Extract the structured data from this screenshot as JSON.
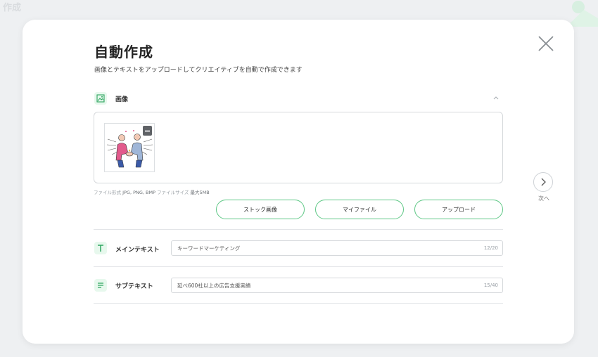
{
  "background": {
    "title": "作成"
  },
  "modal": {
    "title": "自動作成",
    "subtitle": "画像とテキストをアップロードしてクリエイティブを自動で作成できます",
    "next_label": "次へ",
    "image_section": {
      "label": "画像",
      "file_format_label": "ファイル形式",
      "file_format_value": "JPG, PNG, BMP",
      "file_size_label": "ファイルサイズ",
      "file_size_value": "最大5MB",
      "buttons": {
        "stock": "ストック画像",
        "my_files": "マイファイル",
        "upload": "アップロード"
      }
    },
    "main_text": {
      "label": "メインテキスト",
      "value": "キーワードマーケティング",
      "count": "12/20"
    },
    "sub_text": {
      "label": "サブテキスト",
      "value": "延べ600社以上の広告支援実績",
      "count": "15/40"
    }
  },
  "colors": {
    "accent": "#5fc886",
    "icon_bg": "#e7f8ed"
  }
}
